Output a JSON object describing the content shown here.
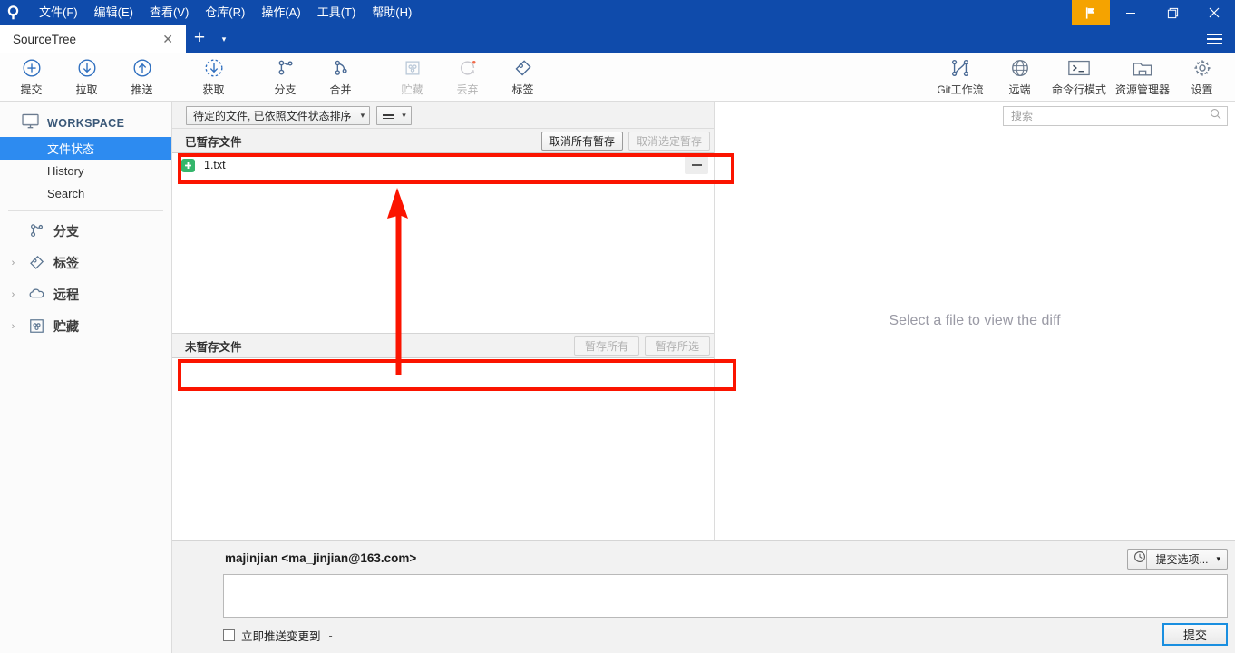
{
  "window": {
    "app_logo_icon": "sourcetree-logo-icon",
    "flag_icon": "flag-icon",
    "minimize_icon": "minimize-icon",
    "maximize_icon": "maximize-icon",
    "close_icon": "close-icon",
    "hamburger_icon": "hamburger-menu-icon"
  },
  "menubar": {
    "items": [
      {
        "label": "文件(F)",
        "text": "文件",
        "accel": "F"
      },
      {
        "label": "编辑(E)",
        "text": "编辑",
        "accel": "E"
      },
      {
        "label": "查看(V)",
        "text": "查看",
        "accel": "V"
      },
      {
        "label": "仓库(R)",
        "text": "仓库",
        "accel": "R"
      },
      {
        "label": "操作(A)",
        "text": "操作",
        "accel": "A"
      },
      {
        "label": "工具(T)",
        "text": "工具",
        "accel": "T"
      },
      {
        "label": "帮助(H)",
        "text": "帮助",
        "accel": "H"
      }
    ]
  },
  "tabbar": {
    "tabs": [
      {
        "label": "SourceTree",
        "close_icon": "close-icon"
      }
    ],
    "add_label": "+",
    "add_caret": "▾"
  },
  "toolbar": {
    "left": [
      {
        "label": "提交",
        "icon": "commit-plus-circle-icon",
        "enabled": true
      },
      {
        "label": "拉取",
        "icon": "pull-down-arrow-circle-icon",
        "enabled": true
      },
      {
        "label": "推送",
        "icon": "push-up-arrow-circle-icon",
        "enabled": true
      },
      {
        "label": "获取",
        "icon": "fetch-dashed-circle-icon",
        "enabled": true
      },
      {
        "label": "分支",
        "icon": "branch-icon",
        "enabled": true
      },
      {
        "label": "合并",
        "icon": "merge-icon",
        "enabled": true
      },
      {
        "label": "贮藏",
        "icon": "stash-box-icon",
        "enabled": false
      },
      {
        "label": "丢弃",
        "icon": "discard-reset-icon",
        "enabled": false
      },
      {
        "label": "标签",
        "icon": "tag-icon",
        "enabled": true
      }
    ],
    "right": [
      {
        "label": "Git工作流",
        "icon": "gitflow-icon"
      },
      {
        "label": "远端",
        "icon": "globe-remote-icon"
      },
      {
        "label": "命令行模式",
        "icon": "terminal-icon"
      },
      {
        "label": "资源管理器",
        "icon": "folder-explorer-icon"
      },
      {
        "label": "设置",
        "icon": "gear-settings-icon"
      }
    ]
  },
  "sidebar": {
    "workspace": {
      "label": "WORKSPACE",
      "icon": "monitor-workspace-icon"
    },
    "sub_items": [
      {
        "label": "文件状态",
        "active": true
      },
      {
        "label": "History",
        "active": false
      },
      {
        "label": "Search",
        "active": false
      }
    ],
    "groups": [
      {
        "label": "分支",
        "icon": "branch-icon",
        "expandable": false,
        "chevron": ""
      },
      {
        "label": "标签",
        "icon": "tag-icon",
        "expandable": true,
        "chevron": "›"
      },
      {
        "label": "远程",
        "icon": "cloud-remote-icon",
        "expandable": true,
        "chevron": "›"
      },
      {
        "label": "贮藏",
        "icon": "stash-box-icon",
        "expandable": true,
        "chevron": "›"
      }
    ]
  },
  "filter_bar": {
    "sort_combo": {
      "value": "待定的文件, 已依照文件状态排序",
      "caret": "▾"
    },
    "view_combo": {
      "icon": "list-lines-icon",
      "caret": "▾"
    }
  },
  "staged_section": {
    "title": "已暂存文件",
    "buttons": [
      {
        "label": "取消所有暂存",
        "enabled": true
      },
      {
        "label": "取消选定暂存",
        "enabled": false
      }
    ],
    "files": [
      {
        "name": "1.txt",
        "status": "added",
        "status_icon": "plus-badge-icon",
        "action_icon": "minus-unstage-icon"
      }
    ]
  },
  "unstaged_section": {
    "title": "未暂存文件",
    "buttons": [
      {
        "label": "暂存所有",
        "enabled": false
      },
      {
        "label": "暂存所选",
        "enabled": false
      }
    ],
    "files": []
  },
  "search": {
    "placeholder": "搜索",
    "value": "",
    "icon": "search-icon"
  },
  "diff_pane": {
    "message": "Select a file to view the diff"
  },
  "commit_area": {
    "author": "majinjian <ma_jinjian@163.com>",
    "message_value": "",
    "message_placeholder": "",
    "history_button_icon": "clock-history-icon",
    "options_button": {
      "label": "提交选项...",
      "caret": "▾"
    },
    "push_checkbox": {
      "label": "立即推送变更到",
      "target": "-",
      "checked": false
    },
    "commit_button": {
      "label": "提交"
    }
  },
  "annotations": {
    "color": "#fb1400",
    "shapes": [
      {
        "name": "staged-file-highlight",
        "type": "rect"
      },
      {
        "name": "unstaged-area-highlight",
        "type": "rect"
      },
      {
        "name": "upward-pointer-arrow",
        "type": "arrow"
      }
    ]
  }
}
